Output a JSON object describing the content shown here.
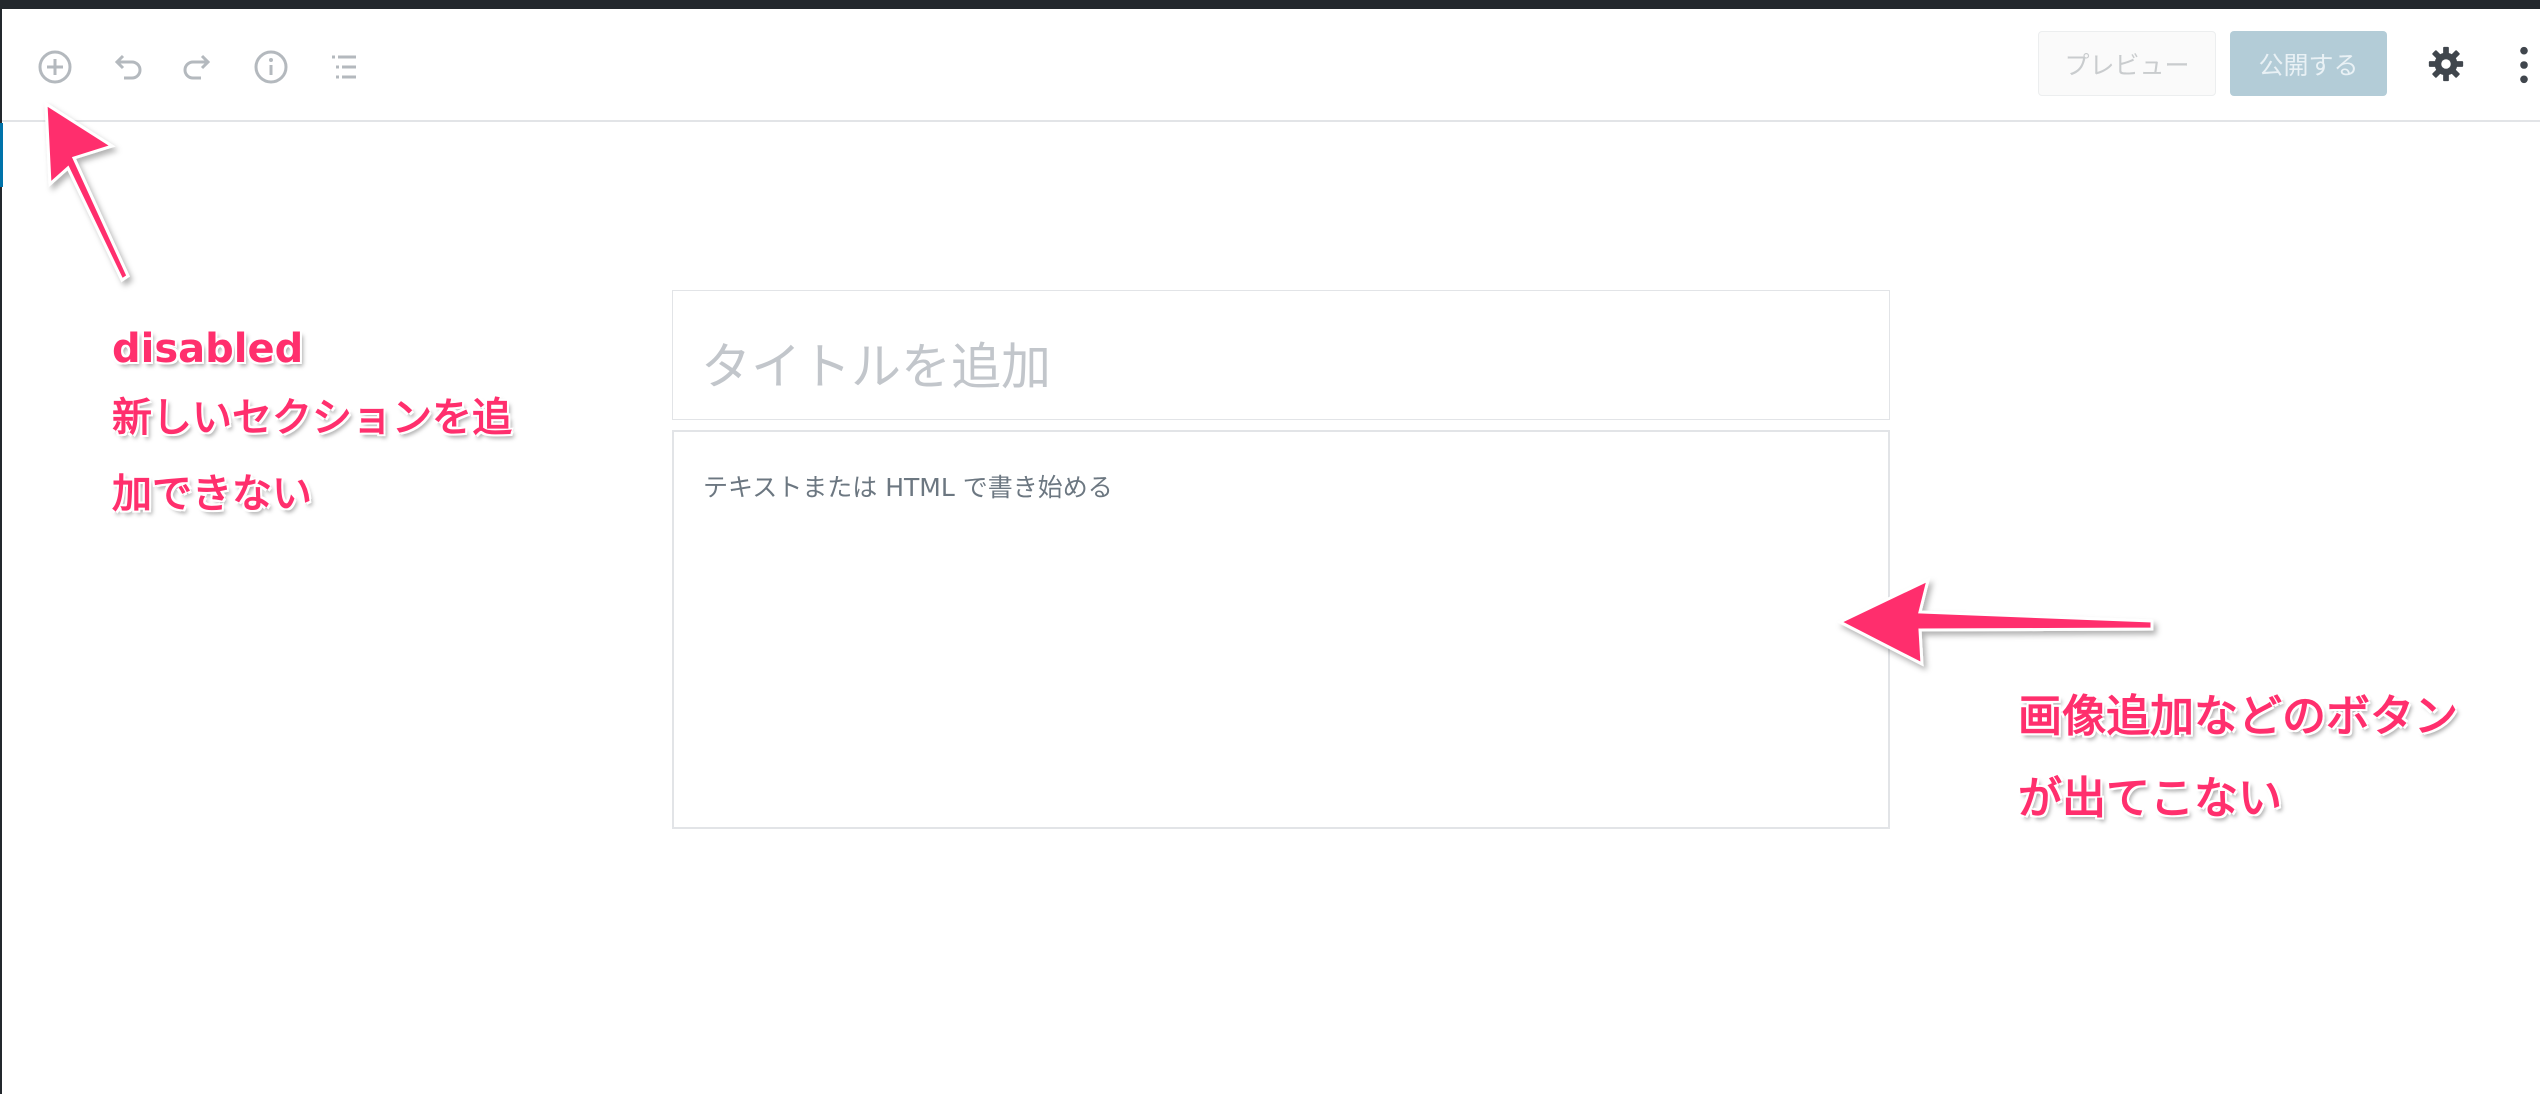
{
  "toolbar": {
    "icons": [
      "add-block-icon",
      "undo-icon",
      "redo-icon",
      "info-icon",
      "block-navigation-icon",
      "gear-icon",
      "more-menu-icon"
    ],
    "preview_label": "プレビュー",
    "publish_label": "公開する",
    "colors": {
      "disabled_icon": "#b4b9be",
      "settings_icon": "#40464d",
      "publish_bg": "#b3ccd7"
    }
  },
  "editor": {
    "title_placeholder": "タイトルを追加",
    "content_placeholder": "テキストまたは HTML で書き始める"
  },
  "annotations": {
    "left": {
      "line1": "disabled",
      "line2": "新しいセクションを追",
      "line3": "加できない"
    },
    "right": {
      "line1": "画像追加などのボタン",
      "line2": "が出てこない"
    },
    "color": "#ff2f6d"
  }
}
